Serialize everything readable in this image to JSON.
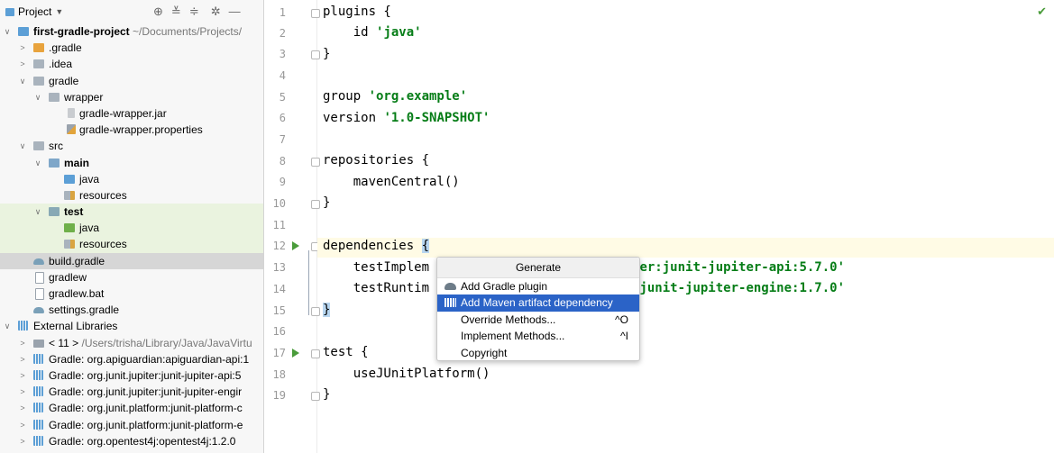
{
  "project_panel": {
    "title": "Project",
    "dropdown_icon": "chevron-down-icon",
    "toolbar_icons": [
      "locate-icon",
      "expand-all-icon",
      "collapse-all-icon",
      "gear-icon",
      "minimize-icon"
    ],
    "tree": [
      {
        "label": "first-gradle-project",
        "path": "~/Documents/Projects/",
        "icon": "module-folder"
      },
      {
        "label": ".gradle",
        "icon": "folder-orange"
      },
      {
        "label": ".idea",
        "icon": "folder"
      },
      {
        "label": "gradle",
        "icon": "folder"
      },
      {
        "label": "wrapper",
        "icon": "folder"
      },
      {
        "label": "gradle-wrapper.jar",
        "icon": "jar"
      },
      {
        "label": "gradle-wrapper.properties",
        "icon": "properties"
      },
      {
        "label": "src",
        "icon": "folder"
      },
      {
        "label": "main",
        "icon": "source-folder"
      },
      {
        "label": "java",
        "icon": "folder-blue"
      },
      {
        "label": "resources",
        "icon": "resources-folder"
      },
      {
        "label": "test",
        "icon": "test-folder"
      },
      {
        "label": "java",
        "icon": "folder-green"
      },
      {
        "label": "resources",
        "icon": "resources-folder"
      },
      {
        "label": "build.gradle",
        "icon": "gradle"
      },
      {
        "label": "gradlew",
        "icon": "file"
      },
      {
        "label": "gradlew.bat",
        "icon": "file"
      },
      {
        "label": "settings.gradle",
        "icon": "gradle"
      },
      {
        "label": "External Libraries",
        "icon": "libraries"
      },
      {
        "label": "< 11 >",
        "path": "/Users/trisha/Library/Java/JavaVirtu",
        "icon": "sdk"
      },
      {
        "label": "Gradle: org.apiguardian:apiguardian-api:1",
        "icon": "library"
      },
      {
        "label": "Gradle: org.junit.jupiter:junit-jupiter-api:5",
        "icon": "library"
      },
      {
        "label": "Gradle: org.junit.jupiter:junit-jupiter-engir",
        "icon": "library"
      },
      {
        "label": "Gradle: org.junit.platform:junit-platform-c",
        "icon": "library"
      },
      {
        "label": "Gradle: org.junit.platform:junit-platform-e",
        "icon": "library"
      },
      {
        "label": "Gradle: org.opentest4j:opentest4j:1.2.0",
        "icon": "library"
      }
    ]
  },
  "editor": {
    "line_numbers": [
      "1",
      "2",
      "3",
      "4",
      "5",
      "6",
      "7",
      "8",
      "9",
      "10",
      "11",
      "12",
      "13",
      "14",
      "15",
      "16",
      "17",
      "18",
      "19"
    ],
    "lines": {
      "l1": "plugins {",
      "l2_pre": "    id ",
      "l2_str": "'java'",
      "l3": "}",
      "l5_pre": "group ",
      "l5_str": "'org.example'",
      "l6_pre": "version ",
      "l6_str": "'1.0-SNAPSHOT'",
      "l8": "repositories {",
      "l9": "    mavenCentral()",
      "l10": "}",
      "l12_pre": "dependencies ",
      "l12_brace": "{",
      "l13_pre": "    testImplem",
      "l13_str": "ter:junit-jupiter-api:5.7.0'",
      "l14_pre": "    testRuntim",
      "l14_str": ":junit-jupiter-engine:1.7.0'",
      "l15": "}",
      "l17": "test {",
      "l18": "    useJUnitPlatform()",
      "l19": "}"
    },
    "status_icon": "checkmark-icon"
  },
  "generate_popup": {
    "title": "Generate",
    "items": [
      {
        "label": "Add Gradle plugin",
        "icon": "gradle-elephant-icon",
        "shortcut": ""
      },
      {
        "label": "Add Maven artifact dependency",
        "icon": "maven-library-icon",
        "shortcut": ""
      },
      {
        "label": "Override Methods...",
        "icon": "",
        "shortcut": "^O"
      },
      {
        "label": "Implement Methods...",
        "icon": "",
        "shortcut": "^I"
      },
      {
        "label": "Copyright",
        "icon": "",
        "shortcut": ""
      }
    ]
  },
  "colors": {
    "string": "#067d17",
    "selection": "#2b63c7",
    "run_gutter": "#4a9c3b",
    "current_line": "#fffbe5"
  }
}
